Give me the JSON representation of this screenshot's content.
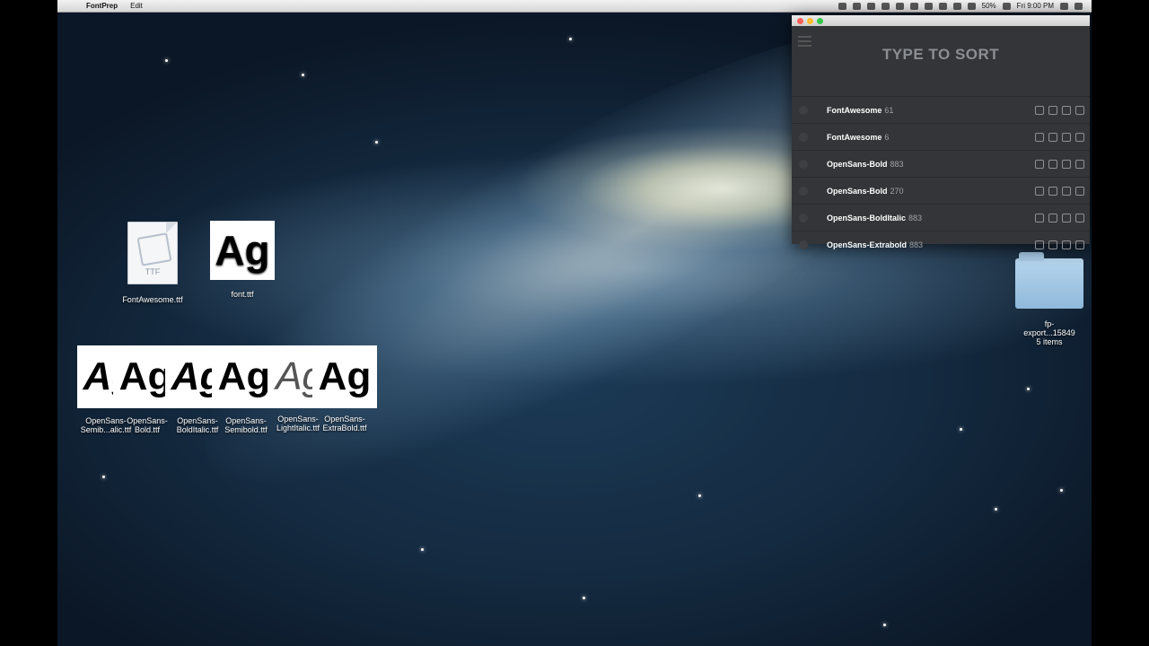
{
  "menubar": {
    "app_name": "FontPrep",
    "menus": [
      "Edit"
    ],
    "battery": "50%",
    "clock": "Fri 9:00 PM"
  },
  "desktop": {
    "icons": {
      "fontawesome_file": {
        "name": "FontAwesome.ttf",
        "kind_label": "TTF"
      },
      "font_file": {
        "name": "font.ttf",
        "preview": "Ag"
      },
      "folder": {
        "name_line1": "fp-",
        "name_line2": "export...15849",
        "sub": "5 items"
      }
    },
    "stack": {
      "preview": "Ag",
      "labels_line1": [
        "OpenSans-",
        "OpenSans-",
        "OpenSans-",
        "OpenSans-",
        "OpenSans-",
        "OpenSans-"
      ],
      "labels_line2": [
        "Semib...alic.ttf",
        "Bold.ttf",
        "BoldItalic.ttf",
        "Semibold.ttf",
        "LightItalic.ttf",
        "ExtraBold.ttf"
      ]
    }
  },
  "fontprep": {
    "title": "TYPE TO SORT",
    "fonts": [
      {
        "name": "FontAwesome",
        "count": "61"
      },
      {
        "name": "FontAwesome",
        "count": "6"
      },
      {
        "name": "OpenSans-Bold",
        "count": "883"
      },
      {
        "name": "OpenSans-Bold",
        "count": "270"
      },
      {
        "name": "OpenSans-BoldItalic",
        "count": "883"
      },
      {
        "name": "OpenSans-Extrabold",
        "count": "883"
      }
    ]
  },
  "colors": {
    "window_bg": "#333538",
    "title_text": "#8b8e92",
    "traffic_red": "#fc5f57",
    "traffic_yellow": "#fdbc2e",
    "traffic_green": "#34c84a"
  }
}
